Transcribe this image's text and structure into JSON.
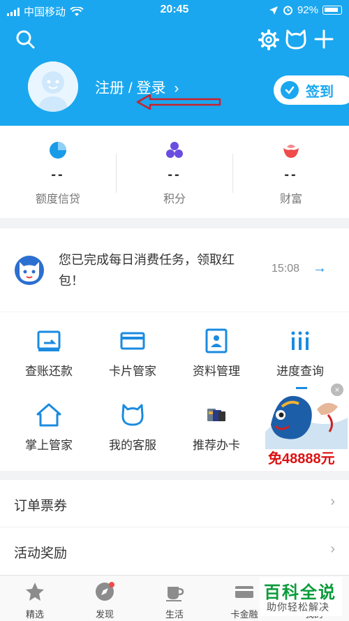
{
  "status_bar": {
    "carrier": "中国移动",
    "time": "20:45",
    "battery": "92%"
  },
  "header": {
    "login_text": "注册 / 登录",
    "chevron": "›",
    "signin_label": "签到",
    "icons": [
      "search-icon",
      "settings-gear-icon",
      "cat-service-icon",
      "plus-icon"
    ],
    "background_color": "#1aa7ef"
  },
  "stats": [
    {
      "value": "--",
      "label": "额度信贷",
      "icon": "pie-icon",
      "color": "#1a9be8"
    },
    {
      "value": "--",
      "label": "积分",
      "icon": "three-dots-icon",
      "color": "#6a4de0"
    },
    {
      "value": "--",
      "label": "财富",
      "icon": "lotus-icon",
      "color": "#f04a4a"
    }
  ],
  "notice": {
    "message": "您已完成每日消费任务，领取红包！",
    "time": "15:08",
    "arrow": "→"
  },
  "grid": [
    {
      "label": "查账还款",
      "icon": "statement-icon"
    },
    {
      "label": "卡片管家",
      "icon": "card-icon"
    },
    {
      "label": "资料管理",
      "icon": "profile-icon"
    },
    {
      "label": "进度查询",
      "icon": "progress-icon"
    },
    {
      "label": "掌上管家",
      "icon": "home-icon"
    },
    {
      "label": "我的客服",
      "icon": "service-cat-icon"
    },
    {
      "label": "推荐办卡",
      "icon": "recommend-card-icon"
    }
  ],
  "ad": {
    "text": "免48888元",
    "close": "×"
  },
  "menu": [
    {
      "label": "订单票券",
      "chevron": "›"
    },
    {
      "label": "活动奖励",
      "chevron": "›"
    }
  ],
  "tabbar": [
    {
      "label": "精选",
      "icon": "star-icon"
    },
    {
      "label": "发现",
      "icon": "compass-icon"
    },
    {
      "label": "生活",
      "icon": "cup-icon"
    },
    {
      "label": "卡金融",
      "icon": "card-finance-icon"
    },
    {
      "label": "我的",
      "icon": "me-icon"
    }
  ],
  "watermark": {
    "title": "百科全说",
    "subtitle": "助你轻松解决"
  }
}
